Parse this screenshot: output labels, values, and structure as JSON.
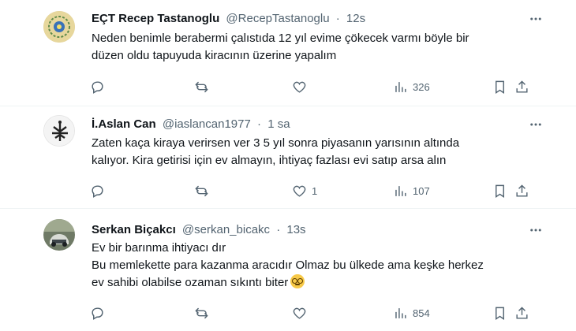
{
  "tweets": [
    {
      "name": "EÇT Recep Tastanoglu",
      "handle": "@RecepTastanoglu",
      "time": "12s",
      "lines": [
        "Neden benimle berabermi çalıstıda 12 yıl evime çökecek varmı böyle bir",
        "düzen oldu tapuyuda kiracının üzerine yapalım"
      ],
      "replies": "",
      "reposts": "",
      "likes": "",
      "views": "326"
    },
    {
      "name": "İ.Aslan Can",
      "handle": "@iaslancan1977",
      "time": "1 sa",
      "lines": [
        "Zaten kaça kiraya verirsen ver 3 5 yıl sonra piyasanın yarısının altında",
        "kalıyor. Kira getirisi için ev almayın, ihtiyaç fazlası evi satıp arsa alın"
      ],
      "replies": "",
      "reposts": "",
      "likes": "1",
      "views": "107"
    },
    {
      "name": "Serkan Biçakcı",
      "handle": "@serkan_bicakc",
      "time": "13s",
      "lines": [
        "Ev bir barınma ihtiyacı dır",
        "Bu memlekette para kazanma aracıdır Olmaz bu ülkede ama keşke herkez",
        "ev sahibi olabilse ozaman sıkıntı biter"
      ],
      "replies": "",
      "reposts": "",
      "likes": "",
      "views": "854",
      "emoji": "nerd-face-emoji"
    }
  ],
  "icons": {
    "reply": "reply-icon",
    "repost": "repost-icon",
    "like": "heart-icon",
    "views": "views-chart-icon",
    "bookmark": "bookmark-icon",
    "share": "share-icon",
    "more": "more-dots-icon"
  },
  "colors": {
    "text": "#0f1419",
    "muted": "#536471",
    "divider": "#eff3f4"
  }
}
